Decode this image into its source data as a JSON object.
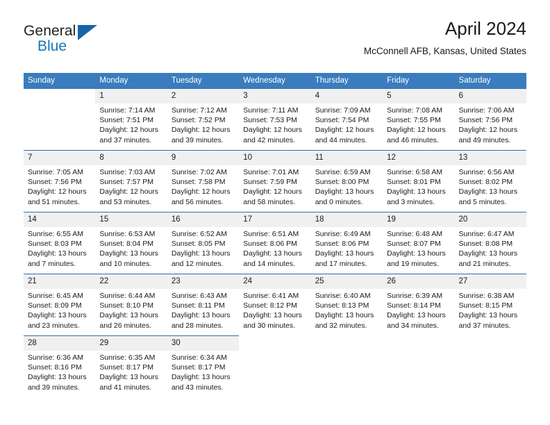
{
  "brand": {
    "name_part1": "General",
    "name_part2": "Blue",
    "triangle_icon": "triangle-logo-icon",
    "accent_color": "#1277bc"
  },
  "header": {
    "title": "April 2024",
    "subtitle": "McConnell AFB, Kansas, United States"
  },
  "theme": {
    "header_blue": "#3a7cbe",
    "row_rule_blue": "#2f6fae",
    "daynum_band": "#f0f0f0"
  },
  "weekday_headers": [
    "Sunday",
    "Monday",
    "Tuesday",
    "Wednesday",
    "Thursday",
    "Friday",
    "Saturday"
  ],
  "weeks": [
    [
      {
        "day": "",
        "empty": true,
        "sunrise": "",
        "sunset": "",
        "daylight_line1": "",
        "daylight_line2": ""
      },
      {
        "day": "1",
        "sunrise": "Sunrise: 7:14 AM",
        "sunset": "Sunset: 7:51 PM",
        "daylight_line1": "Daylight: 12 hours",
        "daylight_line2": "and 37 minutes."
      },
      {
        "day": "2",
        "sunrise": "Sunrise: 7:12 AM",
        "sunset": "Sunset: 7:52 PM",
        "daylight_line1": "Daylight: 12 hours",
        "daylight_line2": "and 39 minutes."
      },
      {
        "day": "3",
        "sunrise": "Sunrise: 7:11 AM",
        "sunset": "Sunset: 7:53 PM",
        "daylight_line1": "Daylight: 12 hours",
        "daylight_line2": "and 42 minutes."
      },
      {
        "day": "4",
        "sunrise": "Sunrise: 7:09 AM",
        "sunset": "Sunset: 7:54 PM",
        "daylight_line1": "Daylight: 12 hours",
        "daylight_line2": "and 44 minutes."
      },
      {
        "day": "5",
        "sunrise": "Sunrise: 7:08 AM",
        "sunset": "Sunset: 7:55 PM",
        "daylight_line1": "Daylight: 12 hours",
        "daylight_line2": "and 46 minutes."
      },
      {
        "day": "6",
        "sunrise": "Sunrise: 7:06 AM",
        "sunset": "Sunset: 7:56 PM",
        "daylight_line1": "Daylight: 12 hours",
        "daylight_line2": "and 49 minutes."
      }
    ],
    [
      {
        "day": "7",
        "sunrise": "Sunrise: 7:05 AM",
        "sunset": "Sunset: 7:56 PM",
        "daylight_line1": "Daylight: 12 hours",
        "daylight_line2": "and 51 minutes."
      },
      {
        "day": "8",
        "sunrise": "Sunrise: 7:03 AM",
        "sunset": "Sunset: 7:57 PM",
        "daylight_line1": "Daylight: 12 hours",
        "daylight_line2": "and 53 minutes."
      },
      {
        "day": "9",
        "sunrise": "Sunrise: 7:02 AM",
        "sunset": "Sunset: 7:58 PM",
        "daylight_line1": "Daylight: 12 hours",
        "daylight_line2": "and 56 minutes."
      },
      {
        "day": "10",
        "sunrise": "Sunrise: 7:01 AM",
        "sunset": "Sunset: 7:59 PM",
        "daylight_line1": "Daylight: 12 hours",
        "daylight_line2": "and 58 minutes."
      },
      {
        "day": "11",
        "sunrise": "Sunrise: 6:59 AM",
        "sunset": "Sunset: 8:00 PM",
        "daylight_line1": "Daylight: 13 hours",
        "daylight_line2": "and 0 minutes."
      },
      {
        "day": "12",
        "sunrise": "Sunrise: 6:58 AM",
        "sunset": "Sunset: 8:01 PM",
        "daylight_line1": "Daylight: 13 hours",
        "daylight_line2": "and 3 minutes."
      },
      {
        "day": "13",
        "sunrise": "Sunrise: 6:56 AM",
        "sunset": "Sunset: 8:02 PM",
        "daylight_line1": "Daylight: 13 hours",
        "daylight_line2": "and 5 minutes."
      }
    ],
    [
      {
        "day": "14",
        "sunrise": "Sunrise: 6:55 AM",
        "sunset": "Sunset: 8:03 PM",
        "daylight_line1": "Daylight: 13 hours",
        "daylight_line2": "and 7 minutes."
      },
      {
        "day": "15",
        "sunrise": "Sunrise: 6:53 AM",
        "sunset": "Sunset: 8:04 PM",
        "daylight_line1": "Daylight: 13 hours",
        "daylight_line2": "and 10 minutes."
      },
      {
        "day": "16",
        "sunrise": "Sunrise: 6:52 AM",
        "sunset": "Sunset: 8:05 PM",
        "daylight_line1": "Daylight: 13 hours",
        "daylight_line2": "and 12 minutes."
      },
      {
        "day": "17",
        "sunrise": "Sunrise: 6:51 AM",
        "sunset": "Sunset: 8:06 PM",
        "daylight_line1": "Daylight: 13 hours",
        "daylight_line2": "and 14 minutes."
      },
      {
        "day": "18",
        "sunrise": "Sunrise: 6:49 AM",
        "sunset": "Sunset: 8:06 PM",
        "daylight_line1": "Daylight: 13 hours",
        "daylight_line2": "and 17 minutes."
      },
      {
        "day": "19",
        "sunrise": "Sunrise: 6:48 AM",
        "sunset": "Sunset: 8:07 PM",
        "daylight_line1": "Daylight: 13 hours",
        "daylight_line2": "and 19 minutes."
      },
      {
        "day": "20",
        "sunrise": "Sunrise: 6:47 AM",
        "sunset": "Sunset: 8:08 PM",
        "daylight_line1": "Daylight: 13 hours",
        "daylight_line2": "and 21 minutes."
      }
    ],
    [
      {
        "day": "21",
        "sunrise": "Sunrise: 6:45 AM",
        "sunset": "Sunset: 8:09 PM",
        "daylight_line1": "Daylight: 13 hours",
        "daylight_line2": "and 23 minutes."
      },
      {
        "day": "22",
        "sunrise": "Sunrise: 6:44 AM",
        "sunset": "Sunset: 8:10 PM",
        "daylight_line1": "Daylight: 13 hours",
        "daylight_line2": "and 26 minutes."
      },
      {
        "day": "23",
        "sunrise": "Sunrise: 6:43 AM",
        "sunset": "Sunset: 8:11 PM",
        "daylight_line1": "Daylight: 13 hours",
        "daylight_line2": "and 28 minutes."
      },
      {
        "day": "24",
        "sunrise": "Sunrise: 6:41 AM",
        "sunset": "Sunset: 8:12 PM",
        "daylight_line1": "Daylight: 13 hours",
        "daylight_line2": "and 30 minutes."
      },
      {
        "day": "25",
        "sunrise": "Sunrise: 6:40 AM",
        "sunset": "Sunset: 8:13 PM",
        "daylight_line1": "Daylight: 13 hours",
        "daylight_line2": "and 32 minutes."
      },
      {
        "day": "26",
        "sunrise": "Sunrise: 6:39 AM",
        "sunset": "Sunset: 8:14 PM",
        "daylight_line1": "Daylight: 13 hours",
        "daylight_line2": "and 34 minutes."
      },
      {
        "day": "27",
        "sunrise": "Sunrise: 6:38 AM",
        "sunset": "Sunset: 8:15 PM",
        "daylight_line1": "Daylight: 13 hours",
        "daylight_line2": "and 37 minutes."
      }
    ],
    [
      {
        "day": "28",
        "sunrise": "Sunrise: 6:36 AM",
        "sunset": "Sunset: 8:16 PM",
        "daylight_line1": "Daylight: 13 hours",
        "daylight_line2": "and 39 minutes."
      },
      {
        "day": "29",
        "sunrise": "Sunrise: 6:35 AM",
        "sunset": "Sunset: 8:17 PM",
        "daylight_line1": "Daylight: 13 hours",
        "daylight_line2": "and 41 minutes."
      },
      {
        "day": "30",
        "sunrise": "Sunrise: 6:34 AM",
        "sunset": "Sunset: 8:17 PM",
        "daylight_line1": "Daylight: 13 hours",
        "daylight_line2": "and 43 minutes."
      },
      {
        "day": "",
        "empty": true,
        "sunrise": "",
        "sunset": "",
        "daylight_line1": "",
        "daylight_line2": ""
      },
      {
        "day": "",
        "empty": true,
        "sunrise": "",
        "sunset": "",
        "daylight_line1": "",
        "daylight_line2": ""
      },
      {
        "day": "",
        "empty": true,
        "sunrise": "",
        "sunset": "",
        "daylight_line1": "",
        "daylight_line2": ""
      },
      {
        "day": "",
        "empty": true,
        "sunrise": "",
        "sunset": "",
        "daylight_line1": "",
        "daylight_line2": ""
      }
    ]
  ]
}
